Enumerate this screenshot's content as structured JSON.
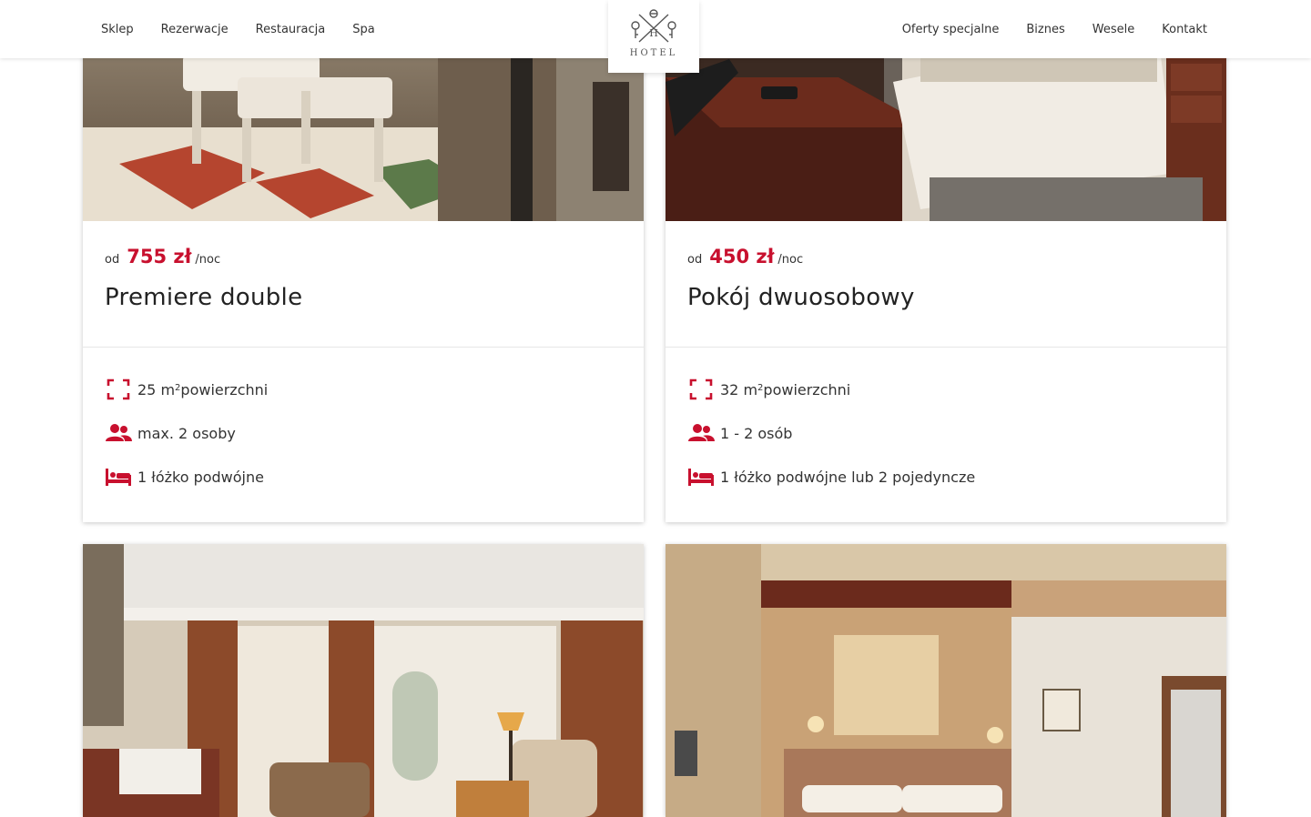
{
  "nav": {
    "left": [
      "Sklep",
      "Rezerwacje",
      "Restauracja",
      "Spa"
    ],
    "right": [
      "Oferty specjalne",
      "Biznes",
      "Wesele",
      "Kontakt"
    ]
  },
  "logo": {
    "letter": "H",
    "text": "HOTEL"
  },
  "colors": {
    "accent": "#c8102e"
  },
  "rooms": [
    {
      "price_prefix": "od",
      "price": "755 zł",
      "price_suffix": "/noc",
      "title": "Premiere double",
      "area_value": "25 m",
      "area_sup": "2",
      "area_label": " powierzchni",
      "capacity": "max. 2 osoby",
      "beds": "1 łóżko podwójne"
    },
    {
      "price_prefix": "od",
      "price": "450 zł",
      "price_suffix": "/noc",
      "title": "Pokój dwuosobowy",
      "area_value": "32 m",
      "area_sup": "2",
      "area_label": " powierzchni",
      "capacity": "1 - 2 osób",
      "beds": "1 łóżko podwójne lub 2 pojedyncze"
    }
  ],
  "icons": [
    "area-icon",
    "people-icon",
    "bed-icon"
  ]
}
